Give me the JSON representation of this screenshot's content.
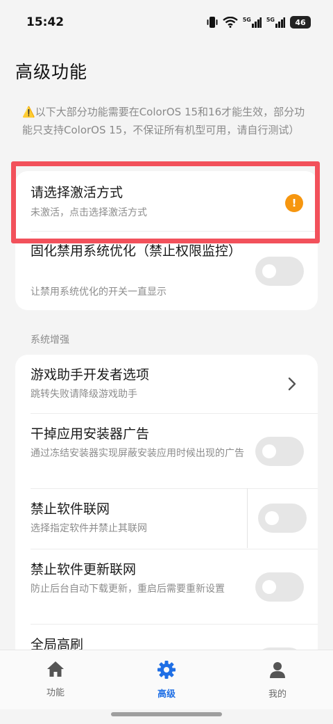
{
  "status_bar": {
    "time": "15:42",
    "network1": "5G",
    "network2": "5G",
    "battery": "46"
  },
  "page": {
    "title": "高级功能",
    "notice": "以下大部分功能需要在ColorOS 15和16才能生效，部分功能只支持ColorOS 15，不保证所有机型可用，请自行测试）",
    "notice_icon": "⚠️"
  },
  "card1": {
    "activation": {
      "title": "请选择激活方式",
      "subtitle": "未激活，点击选择激活方式",
      "badge": "!"
    },
    "fix_disable": {
      "title": "固化禁用系统优化（禁止权限监控）",
      "subtitle": "让禁用系统优化的开关一直显示",
      "enabled": false
    }
  },
  "section_system": {
    "header": "系统增强",
    "items": [
      {
        "title": "游戏助手开发者选项",
        "subtitle": "跳转失败请降级游戏助手",
        "control": "chevron"
      },
      {
        "title": "干掉应用安装器广告",
        "subtitle": "通过冻结安装器实现屏蔽安装应用时候出现的广告",
        "control": "toggle",
        "enabled": false
      },
      {
        "title": "禁止软件联网",
        "subtitle": "选择指定软件并禁止其联网",
        "control": "toggle",
        "enabled": false
      },
      {
        "title": "禁止软件更新联网",
        "subtitle": "防止后台自动下载更新，重启后需要重新设置",
        "control": "toggle",
        "enabled": false
      },
      {
        "title": "全局高刷",
        "subtitle": "",
        "control": "toggle",
        "enabled": false
      }
    ]
  },
  "bottom_nav": {
    "items": [
      {
        "label": "功能",
        "icon": "home-icon",
        "active": false
      },
      {
        "label": "高级",
        "icon": "gear-icon",
        "active": true
      },
      {
        "label": "我的",
        "icon": "person-icon",
        "active": false
      }
    ]
  },
  "colors": {
    "accent": "#1f6fe5",
    "warning": "#f6960f",
    "highlight": "#f2515b"
  }
}
